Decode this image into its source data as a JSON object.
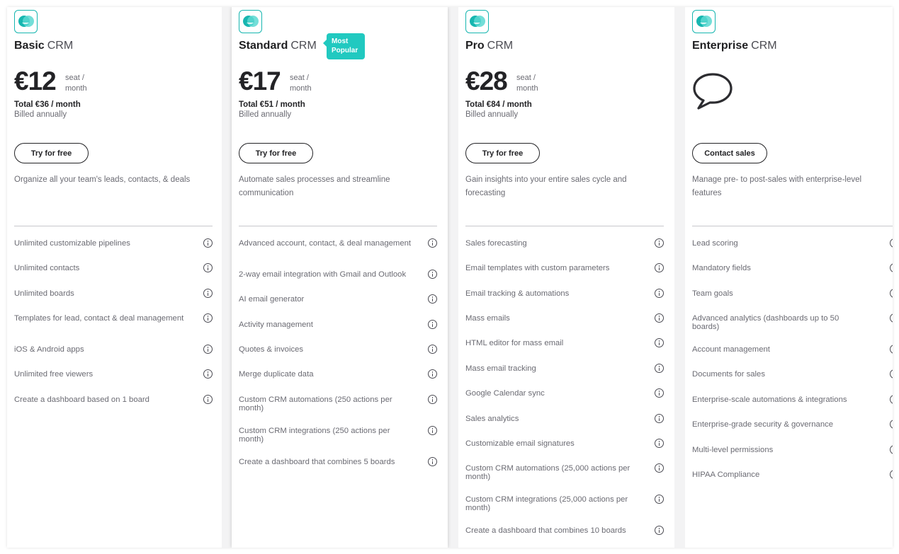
{
  "plans": [
    {
      "name": "Basic",
      "suffix": "CRM",
      "price": "€12",
      "unit_line1": "seat /",
      "unit_line2": "month",
      "total": "Total €36 / month",
      "billed": "Billed annually",
      "cta": "Try for free",
      "description": "Organize all your team's leads, contacts, & deals",
      "features": [
        "Unlimited customizable pipelines",
        "Unlimited contacts",
        "Unlimited boards",
        "Templates for lead, contact & deal management",
        "iOS & Android apps",
        "Unlimited free viewers",
        "Create a dashboard based on 1 board"
      ]
    },
    {
      "name": "Standard",
      "suffix": "CRM",
      "badge_line1": "Most",
      "badge_line2": "Popular",
      "price": "€17",
      "unit_line1": "seat /",
      "unit_line2": "month",
      "total": "Total €51 / month",
      "billed": "Billed annually",
      "cta": "Try for free",
      "description": "Automate sales processes and streamline communication",
      "features": [
        "Advanced account, contact, & deal management",
        "2-way email integration with Gmail and Outlook",
        "AI email generator",
        "Activity management",
        "Quotes & invoices",
        "Merge duplicate data",
        "Custom CRM automations (250 actions per month)",
        "Custom CRM integrations (250 actions per month)",
        "Create a dashboard that combines 5 boards"
      ]
    },
    {
      "name": "Pro",
      "suffix": "CRM",
      "price": "€28",
      "unit_line1": "seat /",
      "unit_line2": "month",
      "total": "Total €84 / month",
      "billed": "Billed annually",
      "cta": "Try for free",
      "description": "Gain insights into your entire sales cycle and forecasting",
      "features": [
        "Sales forecasting",
        "Email templates with custom parameters",
        "Email tracking & automations",
        "Mass emails",
        "HTML editor for mass email",
        "Mass email tracking",
        "Google Calendar sync",
        "Sales analytics",
        "Customizable email signatures",
        "Custom CRM automations (25,000 actions per month)",
        "Custom CRM integrations (25,000 actions per month)",
        "Create a dashboard that combines 10 boards"
      ]
    },
    {
      "name": "Enterprise",
      "suffix": "CRM",
      "cta": "Contact sales",
      "description": "Manage pre- to post-sales with enterprise-level features",
      "features": [
        "Lead scoring",
        "Mandatory fields",
        "Team goals",
        "Advanced analytics (dashboards up to 50 boards)",
        "Account management",
        "Documents for sales",
        "Enterprise-scale automations & integrations",
        "Enterprise-grade security & governance",
        "Multi-level permissions",
        "HIPAA Compliance"
      ]
    }
  ],
  "colors": {
    "accent": "#21c9c0",
    "text_dark": "#232326",
    "text_muted": "#6b6b73"
  }
}
